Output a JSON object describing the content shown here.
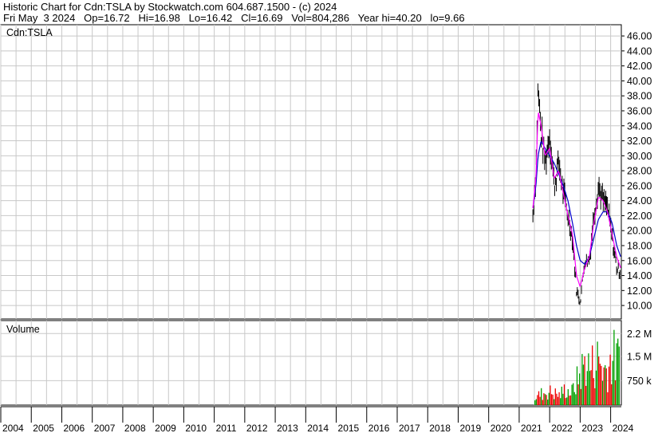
{
  "header": {
    "line1": "Historic Chart for Cdn:TSLA by Stockwatch.com 604.687.1500 - (c) 2024",
    "line2": "Fri May  3 2024   Op=16.72   Hi=16.98   Lo=16.42   Cl=16.69   Vol=804,286   Year hi=40.20   lo=9.66"
  },
  "chart_data": [
    {
      "type": "candlestick",
      "title": "Cdn:TSLA",
      "ylim": [
        8.2,
        47.5
      ],
      "yticks": [
        "46.00",
        "44.00",
        "42.00",
        "40.00",
        "38.00",
        "36.00",
        "34.00",
        "32.00",
        "30.00",
        "28.00",
        "26.00",
        "24.00",
        "22.00",
        "20.00",
        "18.00",
        "16.00",
        "14.00",
        "12.00",
        "10.00"
      ],
      "x": [
        "2021.45",
        "2021.55",
        "2021.62",
        "2021.72",
        "2021.85",
        "2022.0",
        "2022.15",
        "2022.3",
        "2022.45",
        "2022.6",
        "2022.75",
        "2022.88",
        "2023.0",
        "2023.15",
        "2023.3",
        "2023.45",
        "2023.6",
        "2023.75",
        "2023.9",
        "2024.05",
        "2024.2",
        "2024.33"
      ],
      "price": [
        22.0,
        28.0,
        39.0,
        33.0,
        29.0,
        33.0,
        26.0,
        29.0,
        25.0,
        22.0,
        19.0,
        12.0,
        10.5,
        16.0,
        16.0,
        22.0,
        26.0,
        24.0,
        23.0,
        19.0,
        15.0,
        14.5
      ],
      "ma_fast": [
        23.0,
        27.0,
        36.0,
        34.0,
        30.0,
        31.0,
        27.0,
        28.0,
        25.0,
        22.0,
        19.5,
        14.0,
        12.5,
        15.0,
        16.5,
        21.0,
        24.5,
        24.0,
        22.5,
        19.5,
        16.5,
        15.0
      ],
      "ma_slow": [
        23.0,
        26.0,
        30.0,
        32.0,
        31.0,
        30.0,
        29.0,
        27.5,
        26.0,
        24.0,
        21.0,
        18.0,
        16.0,
        15.5,
        16.5,
        19.0,
        21.5,
        22.5,
        22.5,
        21.0,
        18.0,
        16.5
      ],
      "colors": {
        "bars": "#000000",
        "ma_fast": "#ff00ff",
        "ma_slow": "#0000cc"
      }
    },
    {
      "type": "bar",
      "title": "Volume",
      "yticks": [
        "2.2 M",
        "1.5 M",
        "750 k"
      ],
      "ytick_values": [
        2200000,
        1500000,
        750000
      ],
      "ylim": [
        0,
        2600000
      ],
      "x": [
        "2021.5",
        "2021.7",
        "2021.9",
        "2022.1",
        "2022.3",
        "2022.5",
        "2022.7",
        "2022.85",
        "2023.0",
        "2023.15",
        "2023.3",
        "2023.45",
        "2023.6",
        "2023.75",
        "2023.9",
        "2024.05",
        "2024.2",
        "2024.3"
      ],
      "values": [
        300000,
        450000,
        550000,
        500000,
        400000,
        650000,
        500000,
        900000,
        1300000,
        1800000,
        1500000,
        1700000,
        1900000,
        1400000,
        1600000,
        2000000,
        1700000,
        2500000
      ],
      "colors": {
        "up": "#00a000",
        "down": "#ee0000"
      }
    }
  ],
  "x_axis": {
    "labels": [
      "2004",
      "2005",
      "2006",
      "2007",
      "2008",
      "2009",
      "2010",
      "2011",
      "2012",
      "2013",
      "2014",
      "2015",
      "2016",
      "2017",
      "2018",
      "2019",
      "2020",
      "2021",
      "2022",
      "2023",
      "2024"
    ]
  }
}
